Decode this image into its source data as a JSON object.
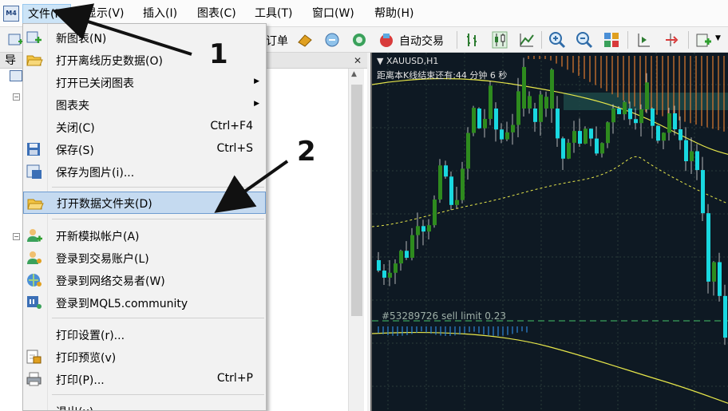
{
  "menubar": {
    "items": [
      {
        "label": "文件(F)"
      },
      {
        "label": "显示(V)"
      },
      {
        "label": "插入(I)"
      },
      {
        "label": "图表(C)"
      },
      {
        "label": "工具(T)"
      },
      {
        "label": "窗口(W)"
      },
      {
        "label": "帮助(H)"
      }
    ]
  },
  "toolbar": {
    "order_label": "订单",
    "autotrade_label": "自动交易"
  },
  "navigator": {
    "title_partial": "导"
  },
  "file_menu": {
    "items": [
      {
        "label": "新图表(N)",
        "shortcut": "",
        "icon": "new-chart-icon"
      },
      {
        "label": "打开离线历史数据(O)",
        "shortcut": "",
        "icon": "open-folder-icon"
      },
      {
        "label": "打开已关闭图表",
        "shortcut": "",
        "submenu": true
      },
      {
        "label": "图表夹",
        "shortcut": "",
        "submenu": true
      },
      {
        "label": "关闭(C)",
        "shortcut": "Ctrl+F4"
      },
      {
        "label": "保存(S)",
        "shortcut": "Ctrl+S",
        "icon": "save-icon"
      },
      {
        "label": "保存为图片(i)...",
        "shortcut": "",
        "icon": "save-picture-icon"
      },
      {
        "label": "打开数据文件夹(D)",
        "shortcut": "",
        "icon": "folder-icon"
      },
      {
        "label": "开新模拟帐户(A)",
        "shortcut": "",
        "icon": "new-account-icon"
      },
      {
        "label": "登录到交易账户(L)",
        "shortcut": "",
        "icon": "login-icon"
      },
      {
        "label": "登录到网络交易者(W)",
        "shortcut": "",
        "icon": "web-trader-icon"
      },
      {
        "label": "登录到MQL5.community",
        "shortcut": "",
        "icon": "mql5-icon"
      },
      {
        "label": "打印设置(r)...",
        "shortcut": ""
      },
      {
        "label": "打印预览(v)",
        "shortcut": "",
        "icon": "print-preview-icon"
      },
      {
        "label": "打印(P)...",
        "shortcut": "Ctrl+P",
        "icon": "print-icon"
      },
      {
        "label": "退出(x)",
        "shortcut": ""
      }
    ]
  },
  "chart": {
    "symbol": "XAUUSD,H1",
    "countdown": "距离本K线结束还有:44 分钟 6 秒",
    "order_line": "#53289726 sell limit 0.23",
    "colors": {
      "bull": "#2e8b1e",
      "bear": "#19d8e0",
      "band": "#e6e64a",
      "bg": "#0e1923"
    }
  },
  "annotations": {
    "step1": "1",
    "step2": "2"
  }
}
